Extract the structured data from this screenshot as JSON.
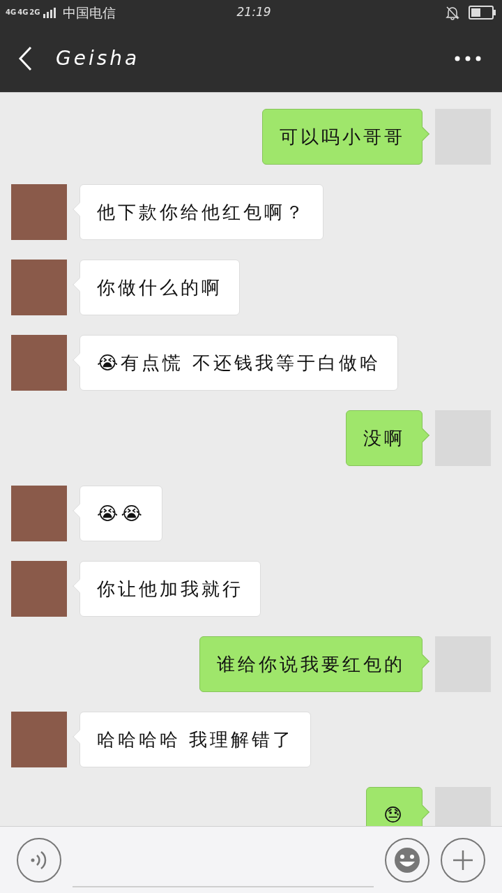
{
  "status_bar": {
    "network_labels": [
      "4G",
      "4G",
      "2G"
    ],
    "carrier": "中国电信",
    "time": "21:19"
  },
  "header": {
    "title": "Geisha"
  },
  "messages": [
    {
      "kind": "sent",
      "text": "可以吗小哥哥"
    },
    {
      "kind": "received",
      "text": "他下款你给他红包啊？"
    },
    {
      "kind": "received",
      "text": "你做什么的啊"
    },
    {
      "kind": "received",
      "text": "😭有点慌  不还钱我等于白做哈"
    },
    {
      "kind": "sent",
      "text": "没啊"
    },
    {
      "kind": "received",
      "text": "😭😭"
    },
    {
      "kind": "received",
      "text": "你让他加我就行"
    },
    {
      "kind": "sent",
      "text": "谁给你说我要红包的"
    },
    {
      "kind": "received",
      "text": "哈哈哈哈  我理解错了"
    },
    {
      "kind": "sent",
      "text": "😓"
    }
  ]
}
